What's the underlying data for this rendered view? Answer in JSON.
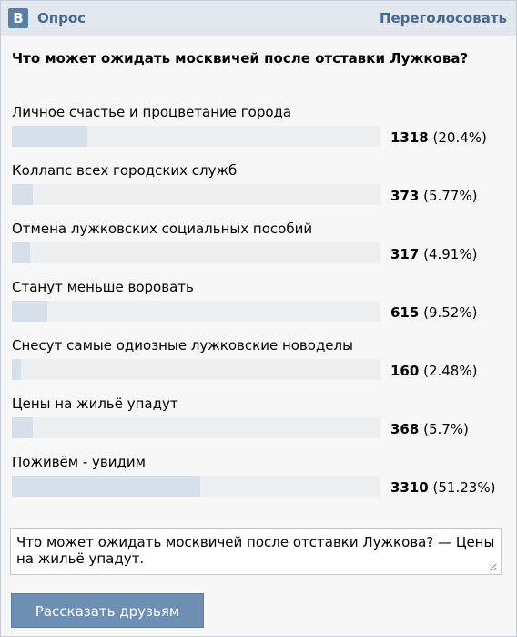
{
  "header": {
    "logo": "В",
    "title": "Опрос",
    "revote": "Переголосовать"
  },
  "poll": {
    "question": "Что может ожидать москвичей после отставки Лужкова?",
    "options": [
      {
        "label": "Личное счастье и процветание города",
        "count": "1318",
        "percent": "(20.4%)",
        "fraction": 0.204
      },
      {
        "label": "Коллапс всех городских служб",
        "count": "373",
        "percent": "(5.77%)",
        "fraction": 0.0577
      },
      {
        "label": "Отмена лужковских социальных пособий",
        "count": "317",
        "percent": "(4.91%)",
        "fraction": 0.0491
      },
      {
        "label": "Станут меньше воровать",
        "count": "615",
        "percent": "(9.52%)",
        "fraction": 0.0952
      },
      {
        "label": "Снесут самые одиозные лужковские новоделы",
        "count": "160",
        "percent": "(2.48%)",
        "fraction": 0.0248
      },
      {
        "label": "Цены на жильё упадут",
        "count": "368",
        "percent": "(5.7%)",
        "fraction": 0.057
      },
      {
        "label": "Поживём - увидим",
        "count": "3310",
        "percent": "(51.23%)",
        "fraction": 0.5123
      }
    ]
  },
  "share": {
    "text": "Что может ожидать москвичей после отставки Лужкова? — Цены на жильё упадут.",
    "button": "Рассказать друзьям"
  },
  "colors": {
    "header_bg": "#e1e7ed",
    "link": "#45688e",
    "bar_fill": "#d7e0ea",
    "bar_track": "#eceff2",
    "button_bg": "#6d8fb3"
  }
}
